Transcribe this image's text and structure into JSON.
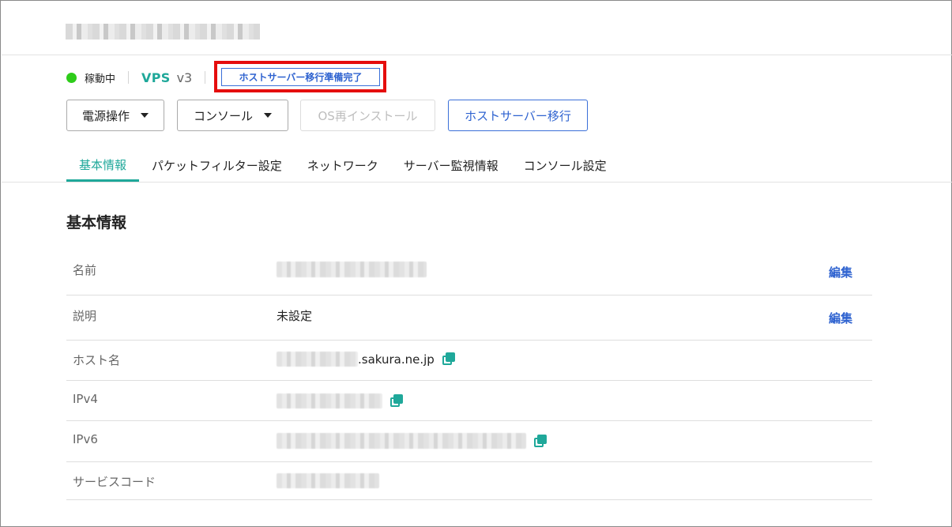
{
  "status": {
    "text": "稼動中",
    "color": "#2ecc1a"
  },
  "product": {
    "name": "VPS",
    "version": "v3"
  },
  "migration_badge": "ホストサーバー移行準備完了",
  "toolbar": {
    "power_label": "電源操作",
    "console_label": "コンソール",
    "reinstall_label": "OS再インストール",
    "migrate_label": "ホストサーバー移行"
  },
  "tabs": [
    {
      "label": "基本情報"
    },
    {
      "label": "パケットフィルター設定"
    },
    {
      "label": "ネットワーク"
    },
    {
      "label": "サーバー監視情報"
    },
    {
      "label": "コンソール設定"
    }
  ],
  "section_title": "基本情報",
  "info": {
    "name_label": "名前",
    "description_label": "説明",
    "description_value": "未設定",
    "hostname_label": "ホスト名",
    "hostname_suffix": ".sakura.ne.jp",
    "ipv4_label": "IPv4",
    "ipv6_label": "IPv6",
    "service_code_label": "サービスコード",
    "edit_label": "編集"
  },
  "colors": {
    "accent_teal": "#1fa89a",
    "link_blue": "#2f63d0",
    "highlight_red": "#e50d0d"
  }
}
